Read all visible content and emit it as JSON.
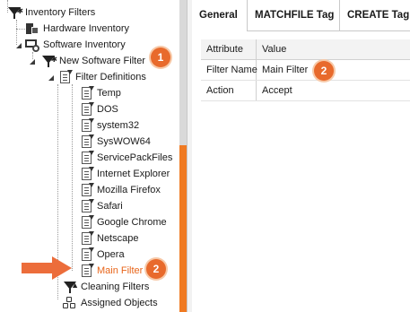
{
  "tree": {
    "top_partial": "...",
    "inventory_filters": "Inventory Filters",
    "hardware_inventory": "Hardware Inventory",
    "software_inventory": "Software Inventory",
    "new_software_filter": "New Software Filter",
    "filter_definitions": "Filter Definitions",
    "items": [
      "Temp",
      "DOS",
      "system32",
      "SysWOW64",
      "ServicePackFiles",
      "Internet Explorer",
      "Mozilla Firefox",
      "Safari",
      "Google Chrome",
      "Netscape",
      "Opera"
    ],
    "selected_item": "Main Filter",
    "cleaning_filters": "Cleaning Filters",
    "assigned_objects": "Assigned Objects"
  },
  "callouts": {
    "badge1": "1",
    "badge2_tree": "2",
    "badge2_grid": "2",
    "accent": "#e86a2c"
  },
  "tabs": {
    "general": "General",
    "matchfile": "MATCHFILE Tag",
    "create": "CREATE Tag"
  },
  "grid": {
    "headers": [
      "Attribute",
      "Value"
    ],
    "rows": [
      {
        "attribute": "Filter Name",
        "value": "Main Filter"
      },
      {
        "attribute": "Action",
        "value": "Accept"
      }
    ]
  }
}
